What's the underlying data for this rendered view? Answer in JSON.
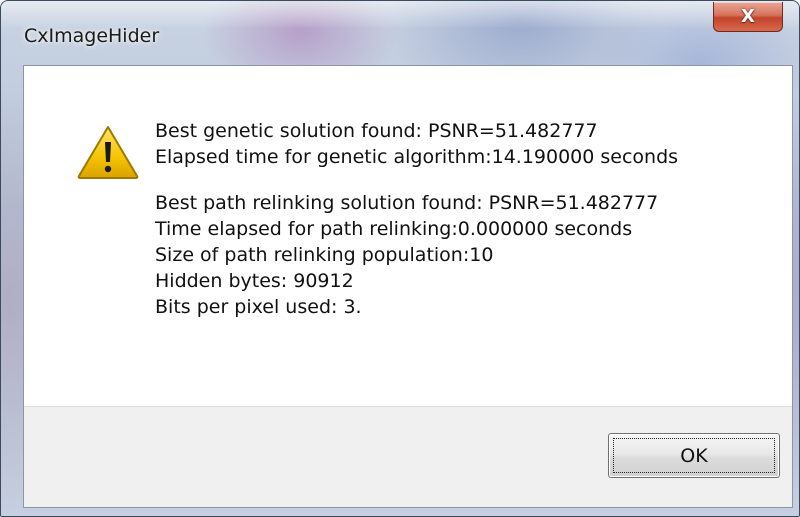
{
  "window": {
    "title": "CxImageHider",
    "close_symbol": "X"
  },
  "dialog": {
    "icon": "warning-icon",
    "messages": [
      "Best genetic solution found: PSNR=51.482777",
      "Elapsed time for genetic algorithm:14.190000 seconds",
      "",
      "Best path relinking solution found: PSNR=51.482777",
      "Time elapsed for path relinking:0.000000 seconds",
      "Size of path relinking population:10",
      "Hidden bytes: 90912",
      "Bits per pixel used: 3."
    ],
    "ok_label": "OK"
  },
  "colors": {
    "close_button": "#c2442b",
    "warning_fill": "#f5c400",
    "client_background": "#ffffff",
    "button_panel": "#f0f0f0"
  }
}
